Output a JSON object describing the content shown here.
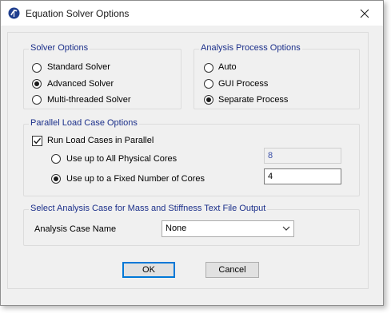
{
  "window": {
    "title": "Equation Solver Options"
  },
  "solver_options": {
    "legend": "Solver Options",
    "items": [
      {
        "label": "Standard Solver",
        "selected": false
      },
      {
        "label": "Advanced Solver",
        "selected": true
      },
      {
        "label": "Multi-threaded Solver",
        "selected": false
      }
    ]
  },
  "analysis_process": {
    "legend": "Analysis Process Options",
    "items": [
      {
        "label": "Auto",
        "selected": false
      },
      {
        "label": "GUI Process",
        "selected": false
      },
      {
        "label": "Separate Process",
        "selected": true
      }
    ]
  },
  "parallel": {
    "legend": "Parallel Load Case Options",
    "run_parallel_label": "Run Load Cases in Parallel",
    "run_parallel_checked": true,
    "all_cores_label": "Use up to All Physical Cores",
    "all_cores_selected": false,
    "all_cores_value": "8",
    "fixed_cores_label": "Use up to a Fixed Number of Cores",
    "fixed_cores_selected": true,
    "fixed_cores_value": "4"
  },
  "mass_stiffness": {
    "legend": "Select Analysis Case for Mass and Stiffness Text File Output",
    "case_name_label": "Analysis Case Name",
    "case_name_value": "None"
  },
  "buttons": {
    "ok": "OK",
    "cancel": "Cancel"
  },
  "colors": {
    "accent": "#0078d7",
    "legend_text": "#1b2f8a"
  }
}
